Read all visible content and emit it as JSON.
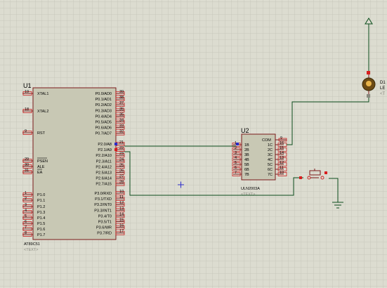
{
  "colors": {
    "background": "#dcdcd0",
    "grid": "#c7c7bb",
    "chip_fill": "#c8c8b4",
    "chip_stroke": "#7a1a1a",
    "pin_line": "#7a1a1a",
    "pin_box": "#c81e1e",
    "wire": "#0b4d1c",
    "text": "#000000",
    "text_text_label": "#8a8a80",
    "pin_dot_blue": "#2c2cc8",
    "pin_dot_red": "#d81e1e",
    "led_body": "#6b4a14",
    "led_glow": "#e8b44a",
    "switch": "#c81e1e"
  },
  "u1": {
    "ref": "U1",
    "part": "AT89C51",
    "text_label": "<TEXT>",
    "left_pins": [
      {
        "num": "19",
        "name": "XTAL1"
      },
      {
        "num": "18",
        "name": "XTAL2"
      },
      {
        "num": "9",
        "name": "RST"
      },
      {
        "num": "29",
        "name": "PSEN"
      },
      {
        "num": "30",
        "name": "ALE"
      },
      {
        "num": "31",
        "name": "EA"
      },
      {
        "num": "1",
        "name": "P1.0"
      },
      {
        "num": "2",
        "name": "P1.1"
      },
      {
        "num": "3",
        "name": "P1.2"
      },
      {
        "num": "4",
        "name": "P1.3"
      },
      {
        "num": "5",
        "name": "P1.4"
      },
      {
        "num": "6",
        "name": "P1.5"
      },
      {
        "num": "7",
        "name": "P1.6"
      },
      {
        "num": "8",
        "name": "P1.7"
      }
    ],
    "right_pins": [
      {
        "num": "39",
        "name": "P0.0/AD0"
      },
      {
        "num": "38",
        "name": "P0.1/AD1"
      },
      {
        "num": "37",
        "name": "P0.2/AD2"
      },
      {
        "num": "36",
        "name": "P0.3/AD3"
      },
      {
        "num": "35",
        "name": "P0.4/AD4"
      },
      {
        "num": "34",
        "name": "P0.5/AD5"
      },
      {
        "num": "33",
        "name": "P0.6/AD6"
      },
      {
        "num": "32",
        "name": "P0.7/AD7"
      },
      {
        "num": "21",
        "name": "P2.0/A8"
      },
      {
        "num": "22",
        "name": "P2.1/A9"
      },
      {
        "num": "23",
        "name": "P2.2/A10"
      },
      {
        "num": "24",
        "name": "P2.3/A11"
      },
      {
        "num": "25",
        "name": "P2.4/A12"
      },
      {
        "num": "26",
        "name": "P2.5/A13"
      },
      {
        "num": "27",
        "name": "P2.6/A14"
      },
      {
        "num": "28",
        "name": "P2.7/A15"
      },
      {
        "num": "10",
        "name": "P3.0/RXD"
      },
      {
        "num": "11",
        "name": "P3.1/TXD"
      },
      {
        "num": "12",
        "name": "P3.2/INT0"
      },
      {
        "num": "13",
        "name": "P3.3/INT1"
      },
      {
        "num": "14",
        "name": "P3.4/T0"
      },
      {
        "num": "15",
        "name": "P3.5/T1"
      },
      {
        "num": "16",
        "name": "P3.6/WR"
      },
      {
        "num": "17",
        "name": "P3.7/RD"
      }
    ]
  },
  "u2": {
    "ref": "U2",
    "part": "ULN2003A",
    "text_label": "<TEXT>",
    "com_label": "COM",
    "com_pin": "9",
    "left_pins": [
      {
        "num": "1",
        "name": "1B"
      },
      {
        "num": "2",
        "name": "2B"
      },
      {
        "num": "3",
        "name": "3B"
      },
      {
        "num": "4",
        "name": "4B"
      },
      {
        "num": "5",
        "name": "5B"
      },
      {
        "num": "6",
        "name": "6B"
      },
      {
        "num": "7",
        "name": "7B"
      }
    ],
    "right_pins": [
      {
        "num": "16",
        "name": "1C"
      },
      {
        "num": "15",
        "name": "2C"
      },
      {
        "num": "14",
        "name": "3C"
      },
      {
        "num": "13",
        "name": "4C"
      },
      {
        "num": "12",
        "name": "5C"
      },
      {
        "num": "11",
        "name": "6C"
      },
      {
        "num": "10",
        "name": "7C"
      }
    ]
  },
  "d1": {
    "ref": "D1",
    "part": "LE",
    "text_label": "<T"
  }
}
